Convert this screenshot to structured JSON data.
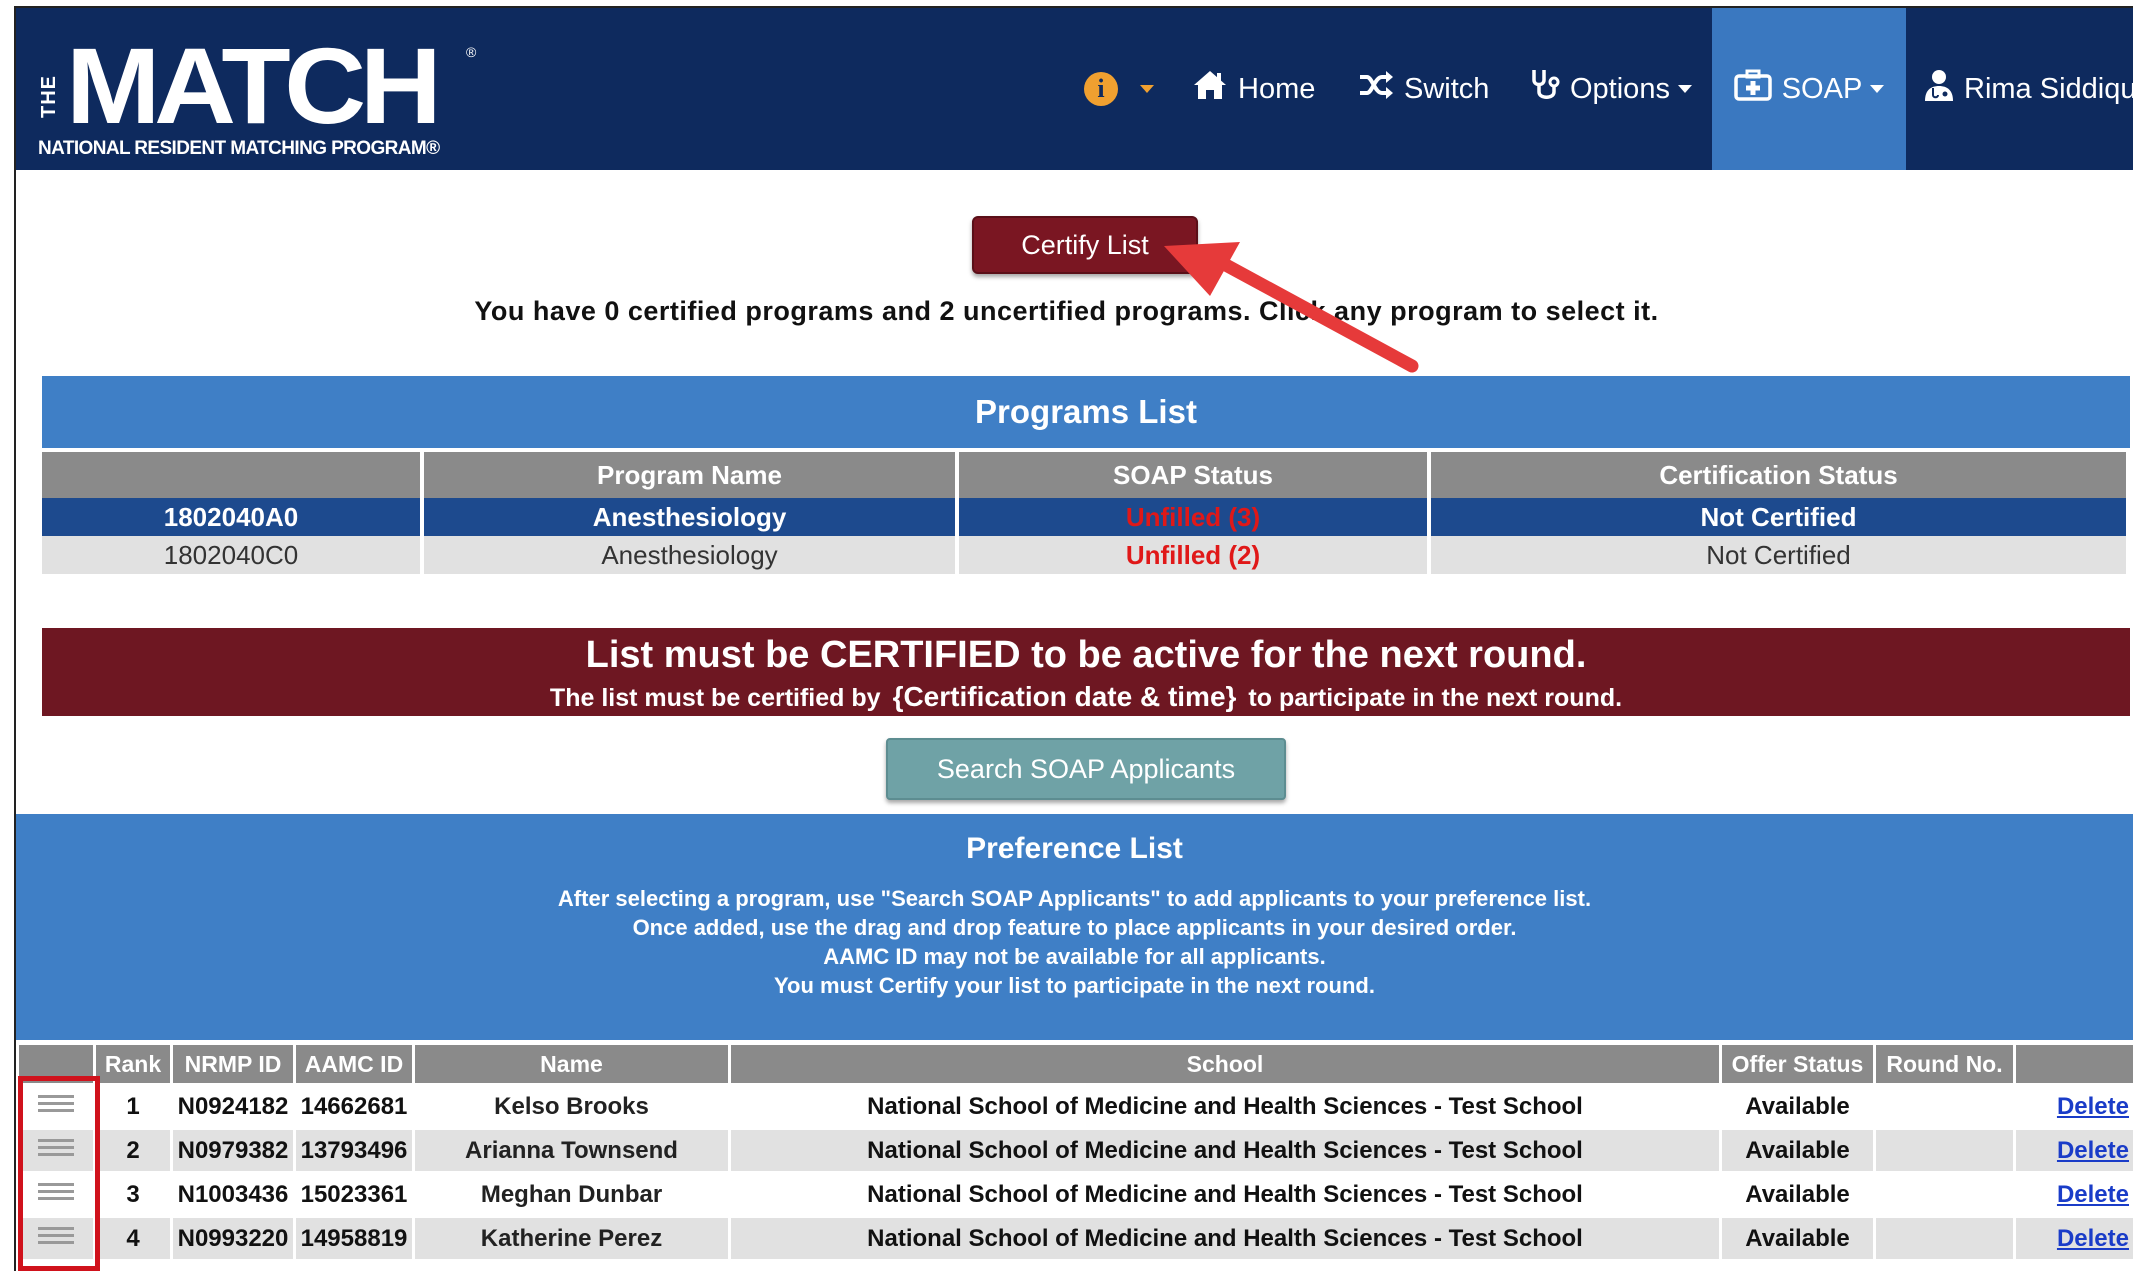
{
  "logo": {
    "the": "THE",
    "word": "MATCH",
    "registered": "®",
    "subtitle": "NATIONAL RESIDENT MATCHING PROGRAM®"
  },
  "nav": {
    "info_icon": "i",
    "home": "Home",
    "switch": "Switch",
    "options": "Options",
    "soap": "SOAP",
    "user": "Rima Siddiqui"
  },
  "certify_button": "Certify List",
  "info_message": "You have 0 certified programs and 2 uncertified programs. Click any program to select it.",
  "programs": {
    "title": "Programs List",
    "columns": [
      "",
      "Program Name",
      "SOAP Status",
      "Certification Status"
    ],
    "rows": [
      {
        "code": "1802040A0",
        "name": "Anesthesiology",
        "status": "Unfilled (3)",
        "cert": "Not Certified",
        "selected": true
      },
      {
        "code": "1802040C0",
        "name": "Anesthesiology",
        "status": "Unfilled (2)",
        "cert": "Not Certified",
        "selected": false
      }
    ]
  },
  "warning": {
    "line1": "List must be CERTIFIED to be active for the next round.",
    "line2_pre": "The list must be certified by",
    "line2_placeholder": "{Certification date & time}",
    "line2_post": "to participate in the next round."
  },
  "search_button": "Search SOAP Applicants",
  "preference": {
    "title": "Preference List",
    "desc": [
      "After selecting a program, use \"Search SOAP Applicants\" to add applicants to your preference list.",
      "Once added, use the drag and drop feature to place applicants in your desired order.",
      "AAMC ID may not be available for all applicants.",
      "You must Certify your list to participate in the next round."
    ],
    "columns": [
      "",
      "Rank",
      "NRMP ID",
      "AAMC ID",
      "Name",
      "School",
      "Offer Status",
      "Round No.",
      ""
    ],
    "rows": [
      {
        "rank": "1",
        "nrmp": "N0924182",
        "aamc": "14662681",
        "name": "Kelso Brooks",
        "school": "National School of Medicine and Health Sciences - Test School",
        "offer": "Available",
        "round": "",
        "action": "Delete"
      },
      {
        "rank": "2",
        "nrmp": "N0979382",
        "aamc": "13793496",
        "name": "Arianna Townsend",
        "school": "National School of Medicine and Health Sciences - Test School",
        "offer": "Available",
        "round": "",
        "action": "Delete"
      },
      {
        "rank": "3",
        "nrmp": "N1003436",
        "aamc": "15023361",
        "name": "Meghan Dunbar",
        "school": "National School of Medicine and Health Sciences - Test School",
        "offer": "Available",
        "round": "",
        "action": "Delete"
      },
      {
        "rank": "4",
        "nrmp": "N0993220",
        "aamc": "14958819",
        "name": "Katherine Perez",
        "school": "National School of Medicine and Health Sciences - Test School",
        "offer": "Available",
        "round": "",
        "action": "Delete"
      }
    ]
  },
  "colors": {
    "navy": "#0e2a5e",
    "accent_blue": "#3f7fc6",
    "maroon": "#7a1622",
    "teal": "#6fa2a6",
    "alert_red": "#e01818",
    "annotation_red": "#d0121c"
  },
  "icons": [
    "info-icon",
    "home-icon",
    "shuffle-icon",
    "stethoscope-icon",
    "medical-kit-icon",
    "user-doctor-icon",
    "drag-handle-icon",
    "arrow-annotation"
  ]
}
